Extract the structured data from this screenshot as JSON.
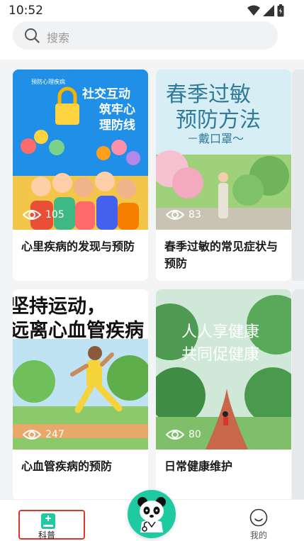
{
  "status": {
    "time": "10:52"
  },
  "search": {
    "placeholder": "搜索"
  },
  "cards": [
    {
      "title": "心里疾病的发现与预防",
      "views": "105",
      "image_texts": {
        "logo": "预防心理疾病",
        "headline_1": "社交互动",
        "headline_2": "筑牢心",
        "headline_3": "理防线"
      }
    },
    {
      "title": "春季过敏的常见症状与预防",
      "views": "83",
      "image_texts": {
        "headline_1": "春季过敏",
        "headline_2": "预防方法",
        "sub": "－戴口罩～"
      }
    },
    {
      "title": "心血管疾病的预防",
      "views": "247",
      "image_texts": {
        "headline_1": "坚持运动，",
        "headline_2": "远离心血管疾病"
      }
    },
    {
      "title": "日常健康维护",
      "views": "80",
      "image_texts": {
        "headline_1": "人人享健康",
        "headline_2": "共同促健康"
      }
    }
  ],
  "nav": {
    "science_label": "科普",
    "mine_label": "我的"
  },
  "colors": {
    "accent": "#1ecba0",
    "highlight_border": "#e1352a"
  }
}
